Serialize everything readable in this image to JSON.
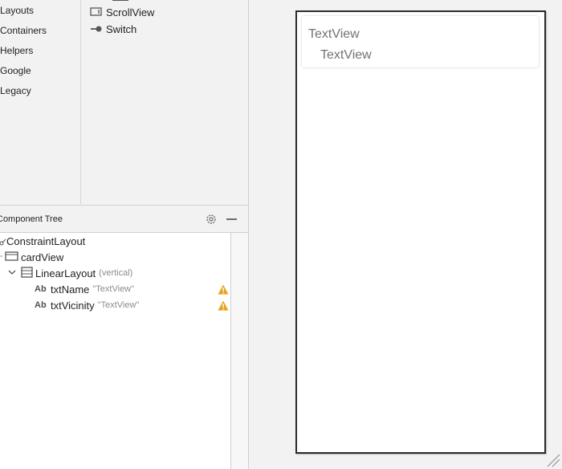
{
  "palette_categories": [
    "Layouts",
    "Containers",
    "Helpers",
    "Google",
    "Legacy"
  ],
  "palette_items": [
    {
      "label": "ScrollView",
      "icon": "scrollview-icon"
    },
    {
      "label": "Switch",
      "icon": "switch-icon"
    }
  ],
  "component_tree": {
    "title": "Component Tree",
    "nodes": [
      {
        "label": "ConstraintLayout",
        "hint": ""
      },
      {
        "label": "cardView",
        "hint": ""
      },
      {
        "label": "LinearLayout",
        "hint": "(vertical)"
      },
      {
        "label": "txtName",
        "hint": "\"TextView\"",
        "badge": "Ab",
        "warning": true
      },
      {
        "label": "txtVicinity",
        "hint": "\"TextView\"",
        "badge": "Ab",
        "warning": true
      }
    ]
  },
  "preview": {
    "text_view_1": "TextView",
    "text_view_2": "TextView"
  },
  "colors": {
    "warning": "#e5a41a",
    "hint": "#8c8c8c",
    "preview_text": "#737373"
  }
}
